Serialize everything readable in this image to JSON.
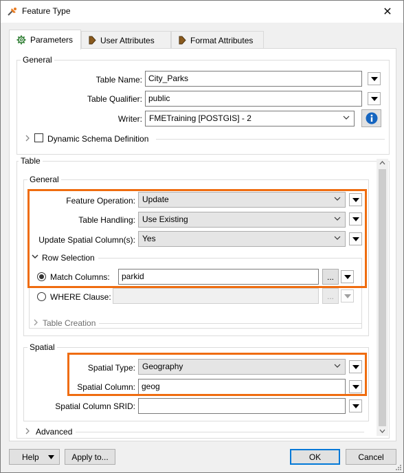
{
  "window": {
    "title": "Feature Type",
    "close_glyph": "✕"
  },
  "tabs": [
    {
      "label": "Parameters",
      "icon": "gear-icon",
      "active": true
    },
    {
      "label": "User Attributes",
      "icon": "arrow-icon",
      "active": false
    },
    {
      "label": "Format Attributes",
      "icon": "arrow-icon",
      "active": false
    }
  ],
  "general": {
    "group_label": "General",
    "table_name_label": "Table Name:",
    "table_name_value": "City_Parks",
    "table_qualifier_label": "Table Qualifier:",
    "table_qualifier_value": "public",
    "writer_label": "Writer:",
    "writer_value": "FMETraining [POSTGIS] - 2",
    "dynamic_schema_label": "Dynamic Schema Definition",
    "dynamic_schema_checked": false
  },
  "table": {
    "group_label": "Table",
    "general_label": "General",
    "feature_operation_label": "Feature Operation:",
    "feature_operation_value": "Update",
    "table_handling_label": "Table Handling:",
    "table_handling_value": "Use Existing",
    "update_spatial_label": "Update Spatial Column(s):",
    "update_spatial_value": "Yes",
    "row_selection_label": "Row Selection",
    "match_columns_label": "Match Columns:",
    "match_columns_value": "parkid",
    "match_columns_selected": true,
    "where_clause_label": "WHERE Clause:",
    "where_clause_value": "",
    "ellipsis": "...",
    "table_creation_label": "Table Creation"
  },
  "spatial": {
    "group_label": "Spatial",
    "spatial_type_label": "Spatial Type:",
    "spatial_type_value": "Geography",
    "spatial_column_label": "Spatial Column:",
    "spatial_column_value": "geog",
    "srid_label": "Spatial Column SRID:",
    "srid_value": ""
  },
  "advanced_label": "Advanced",
  "footer": {
    "help_label": "Help",
    "apply_label": "Apply to...",
    "ok_label": "OK",
    "cancel_label": "Cancel"
  },
  "colors": {
    "highlight": "#ef6c0f",
    "info_button": "#1565c0",
    "default_button_border": "#0078d7"
  }
}
